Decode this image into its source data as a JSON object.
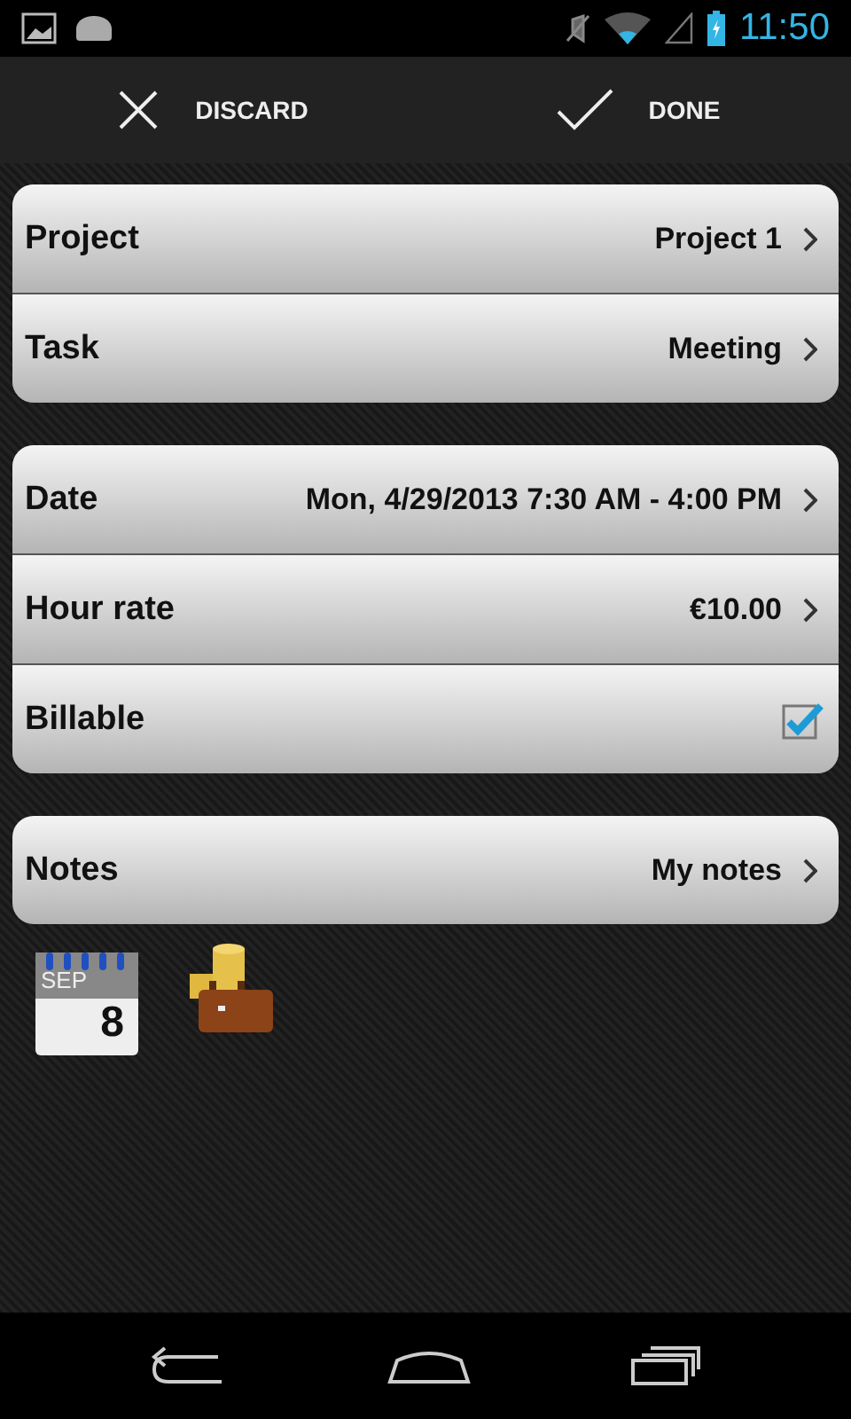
{
  "status_bar": {
    "time": "11:50"
  },
  "action_bar": [
    {
      "kind": "discard",
      "label": "DISCARD"
    },
    {
      "kind": "done",
      "label": "DONE"
    }
  ],
  "groups": [
    {
      "rows": [
        {
          "kind": "link",
          "label": "Project",
          "value": "Project 1"
        },
        {
          "kind": "link",
          "label": "Task",
          "value": "Meeting"
        }
      ]
    },
    {
      "rows": [
        {
          "kind": "link",
          "label": "Date",
          "value": "Mon, 4/29/2013 7:30 AM - 4:00 PM"
        },
        {
          "kind": "link",
          "label": "Hour rate",
          "value": "€10.00"
        },
        {
          "kind": "checkbox",
          "label": "Billable",
          "checked": true
        }
      ]
    },
    {
      "rows": [
        {
          "kind": "link",
          "label": "Notes",
          "value": "My notes"
        }
      ]
    }
  ],
  "calendar_icon": {
    "month": "SEP",
    "day": "8"
  }
}
